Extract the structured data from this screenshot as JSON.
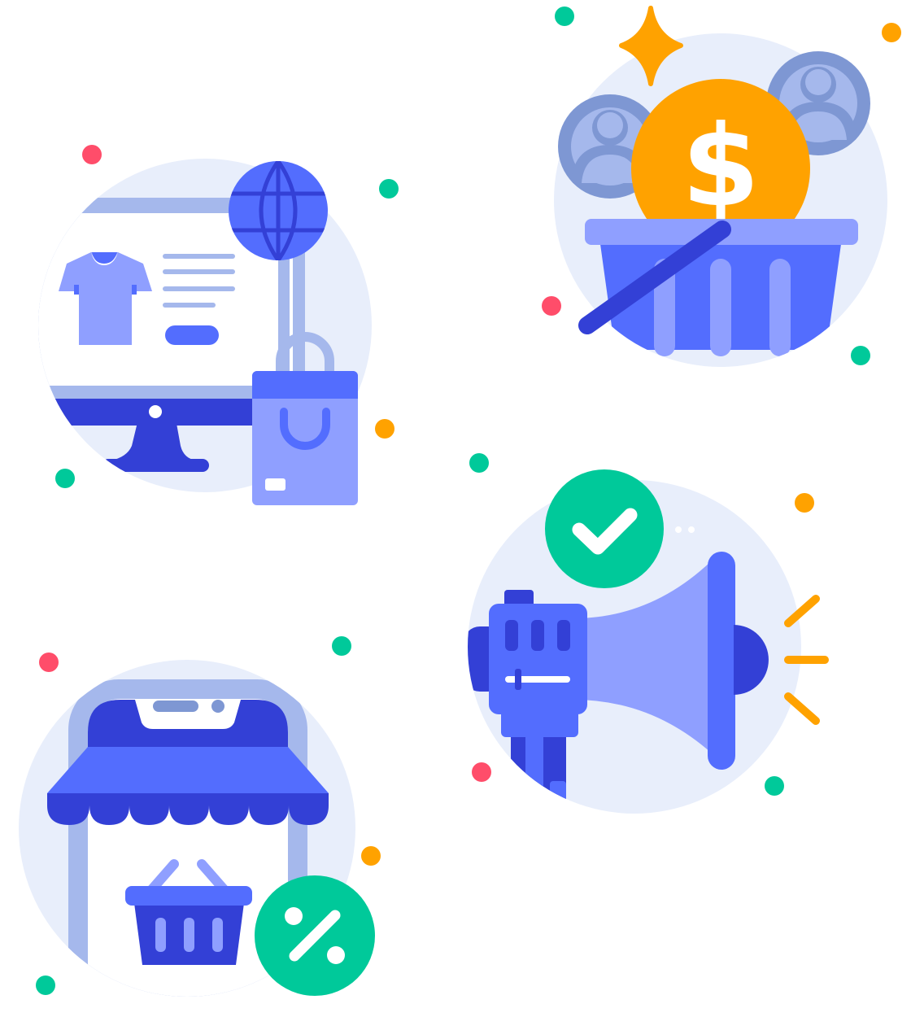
{
  "palette": {
    "bg_circle": "#E8EEFB",
    "light_blue": "#A5B8EC",
    "mid_blue": "#8F9FFF",
    "blue": "#536DFE",
    "dark_blue": "#3340D6",
    "gray_blue": "#7E97D3",
    "orange": "#FFA200",
    "green": "#00C99A",
    "red": "#FF4D6A",
    "white": "#FFFFFF"
  },
  "scenes": [
    {
      "name": "online-store-scene",
      "icons": [
        "monitor-icon",
        "tshirt-icon",
        "globe-icon",
        "shopping-bag-icon"
      ]
    },
    {
      "name": "paid-basket-scene",
      "icons": [
        "sparkle-icon",
        "user-avatar-icon",
        "dollar-coin-icon",
        "basket-icon"
      ]
    },
    {
      "name": "marketing-scene",
      "icons": [
        "megaphone-icon",
        "check-badge-icon",
        "sound-waves-icon"
      ]
    },
    {
      "name": "discount-shop-scene",
      "icons": [
        "storefront-icon",
        "awning-icon",
        "basket-icon",
        "percent-badge-icon"
      ]
    }
  ],
  "dollar_symbol": "$",
  "percent_symbol": "%"
}
